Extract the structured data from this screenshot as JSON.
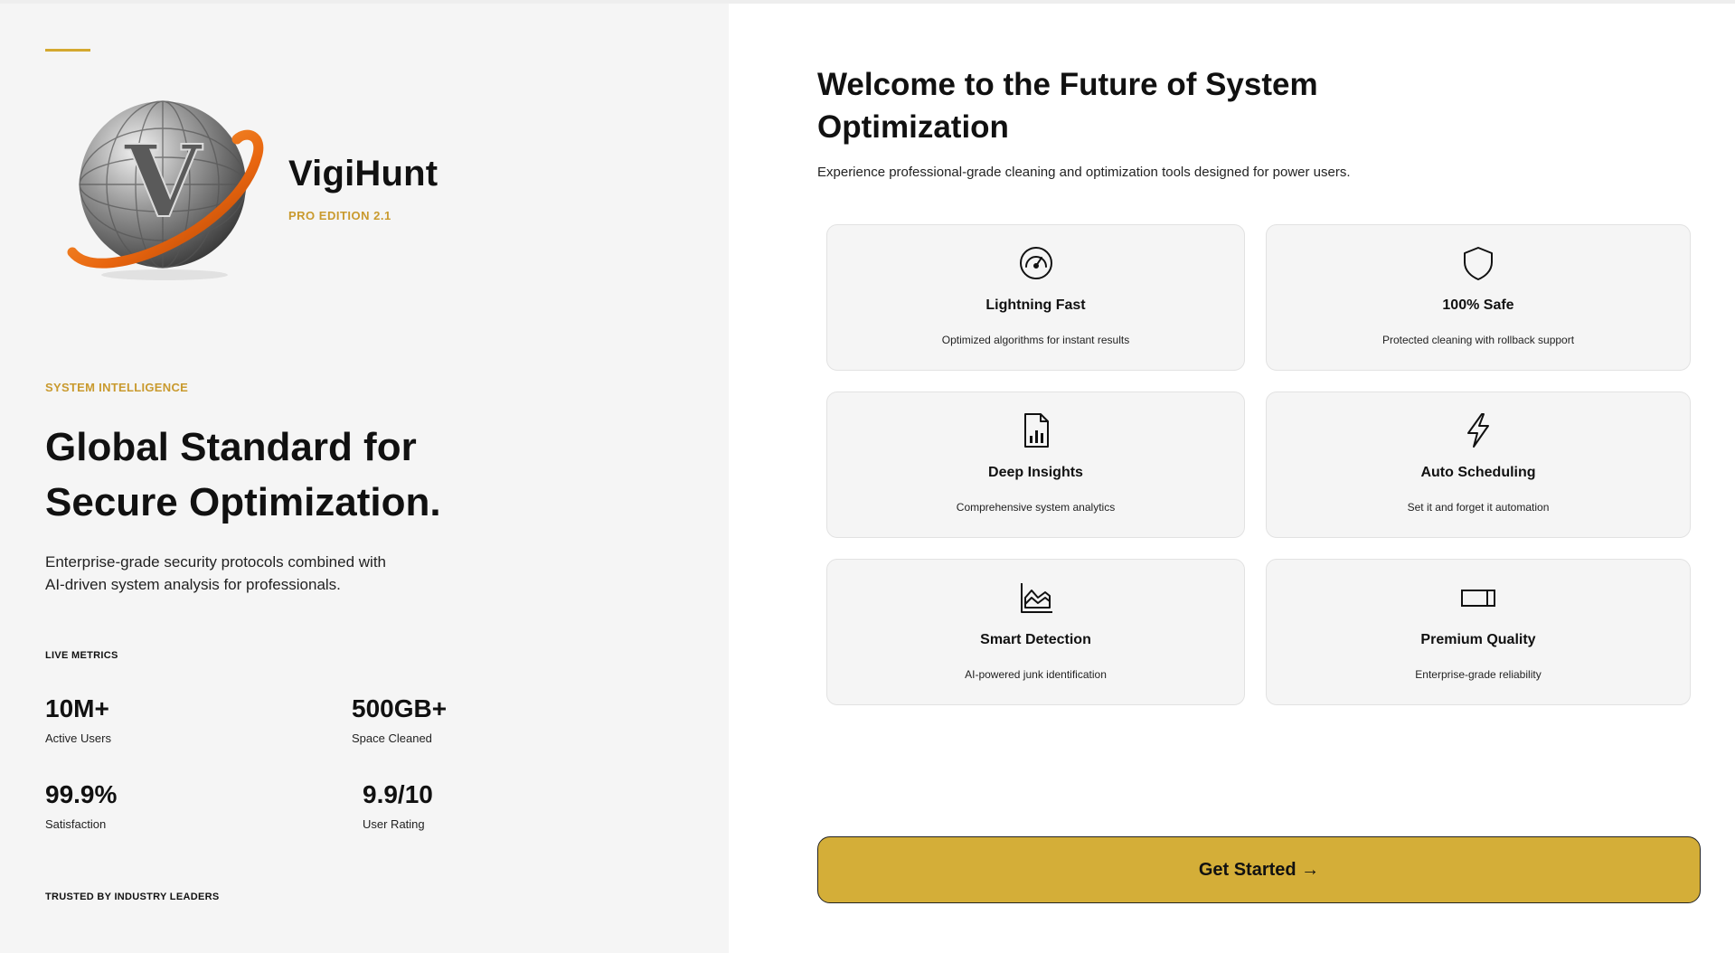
{
  "brand": {
    "name": "VigiHunt",
    "edition": "PRO EDITION 2.1",
    "accent_color": "#d4a82f",
    "logo_icon": "globe-v-logo"
  },
  "hero": {
    "eyebrow": "SYSTEM INTELLIGENCE",
    "headline_line1": "Global Standard for",
    "headline_line2": "Secure Optimization.",
    "subtext_line1": "Enterprise-grade security protocols combined with",
    "subtext_line2": "AI-driven system analysis for professionals."
  },
  "metrics": {
    "label": "LIVE METRICS",
    "items": [
      {
        "value": "10M+",
        "label": "Active Users"
      },
      {
        "value": "500GB+",
        "label": "Space Cleaned"
      },
      {
        "value": "99.9%",
        "label": "Satisfaction"
      },
      {
        "value": "9.9/10",
        "label": "User Rating"
      }
    ]
  },
  "trusted_label": "TRUSTED BY INDUSTRY LEADERS",
  "welcome": {
    "title_line1": "Welcome to the Future of System",
    "title_line2": "Optimization",
    "subtitle": "Experience professional-grade cleaning and optimization tools designed for power users."
  },
  "features": [
    {
      "icon": "speedometer-icon",
      "title": "Lightning Fast",
      "desc": "Optimized algorithms for instant results"
    },
    {
      "icon": "shield-icon",
      "title": "100% Safe",
      "desc": "Protected cleaning with rollback support"
    },
    {
      "icon": "report-chart-icon",
      "title": "Deep Insights",
      "desc": "Comprehensive system analytics"
    },
    {
      "icon": "lightning-icon",
      "title": "Auto Scheduling",
      "desc": "Set it and forget it automation"
    },
    {
      "icon": "area-chart-icon",
      "title": "Smart Detection",
      "desc": "AI-powered junk identification"
    },
    {
      "icon": "battery-icon",
      "title": "Premium Quality",
      "desc": "Enterprise-grade reliability"
    }
  ],
  "cta": {
    "label": "Get Started →",
    "color": "#d4ae38"
  }
}
